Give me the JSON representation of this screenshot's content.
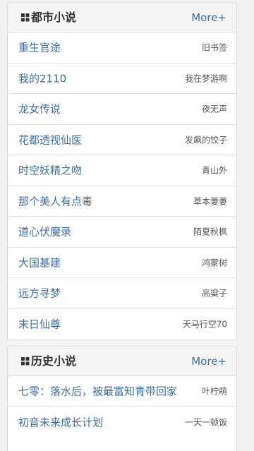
{
  "sections": [
    {
      "title": "都市小说",
      "more_label": "More+",
      "icon": "grid-icon",
      "items": [
        {
          "title": "重生官途",
          "author": "旧书签"
        },
        {
          "title": "我的2110",
          "author": "我在梦游啊"
        },
        {
          "title": "龙女传说",
          "author": "夜无声"
        },
        {
          "title": "花都透视仙医",
          "author": "发飙的饺子"
        },
        {
          "title": "时空妖精之吻",
          "author": "青山外"
        },
        {
          "title": "那个美人有点毒",
          "author": "草本萋萋"
        },
        {
          "title": "道心伏魔录",
          "author": "陌夏秋枫"
        },
        {
          "title": "大国基建",
          "author": "鸿蒙树"
        },
        {
          "title": "远方寻梦",
          "author": "高粱子"
        },
        {
          "title": "末日仙尊",
          "author": "天马行空70"
        }
      ]
    },
    {
      "title": "历史小说",
      "more_label": "More+",
      "icon": "grid-icon",
      "items": [
        {
          "title": "七零：落水后，被最富知青带回家",
          "author": "叶柠萌"
        },
        {
          "title": "初音未来成长计划",
          "author": "一天一顿饭"
        }
      ]
    }
  ],
  "colors": {
    "link": "#3a6ea5",
    "header_bg": "#f5f5f5",
    "border": "#dddddd",
    "page_bg": "#f2f2f2"
  }
}
